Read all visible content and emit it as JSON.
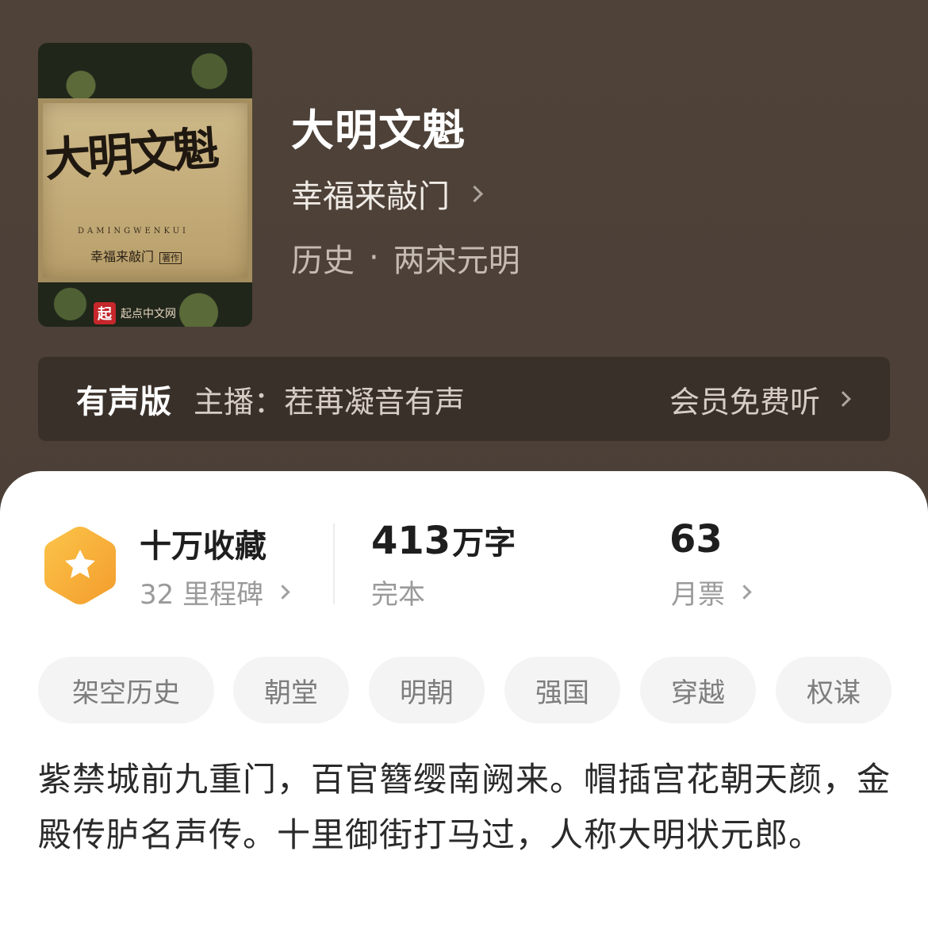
{
  "cover": {
    "title": "大明文魁",
    "pinyin": "DAMINGWENKUI",
    "author": "幸福来敲门",
    "author_tag": "著作",
    "publisher_mark": "起",
    "publisher": "起点中文网"
  },
  "book": {
    "title": "大明文魁",
    "author": "幸福来敲门",
    "category": "历史",
    "separator": "·",
    "subcategory": "两宋元明"
  },
  "audio": {
    "label": "有声版",
    "host": "主播：茬苒凝音有声",
    "cta": "会员免费听"
  },
  "stats": {
    "collection": {
      "title": "十万收藏",
      "sub": "32 里程碑"
    },
    "words": {
      "value": "413",
      "unit": "万字",
      "sub": "完本"
    },
    "tickets": {
      "value": "63",
      "sub": "月票"
    }
  },
  "tags": [
    "架空历史",
    "朝堂",
    "明朝",
    "强国",
    "穿越",
    "权谋"
  ],
  "description": "紫禁城前九重门，百官簪缨南阙来。帽插宫花朝天颜，金殿传胪名声传。十里御街打马过，人称大明状元郎。",
  "colors": {
    "header_bg": "#4c4038",
    "badge_orange": "#f7b13a",
    "card_bg": "#ffffff"
  }
}
